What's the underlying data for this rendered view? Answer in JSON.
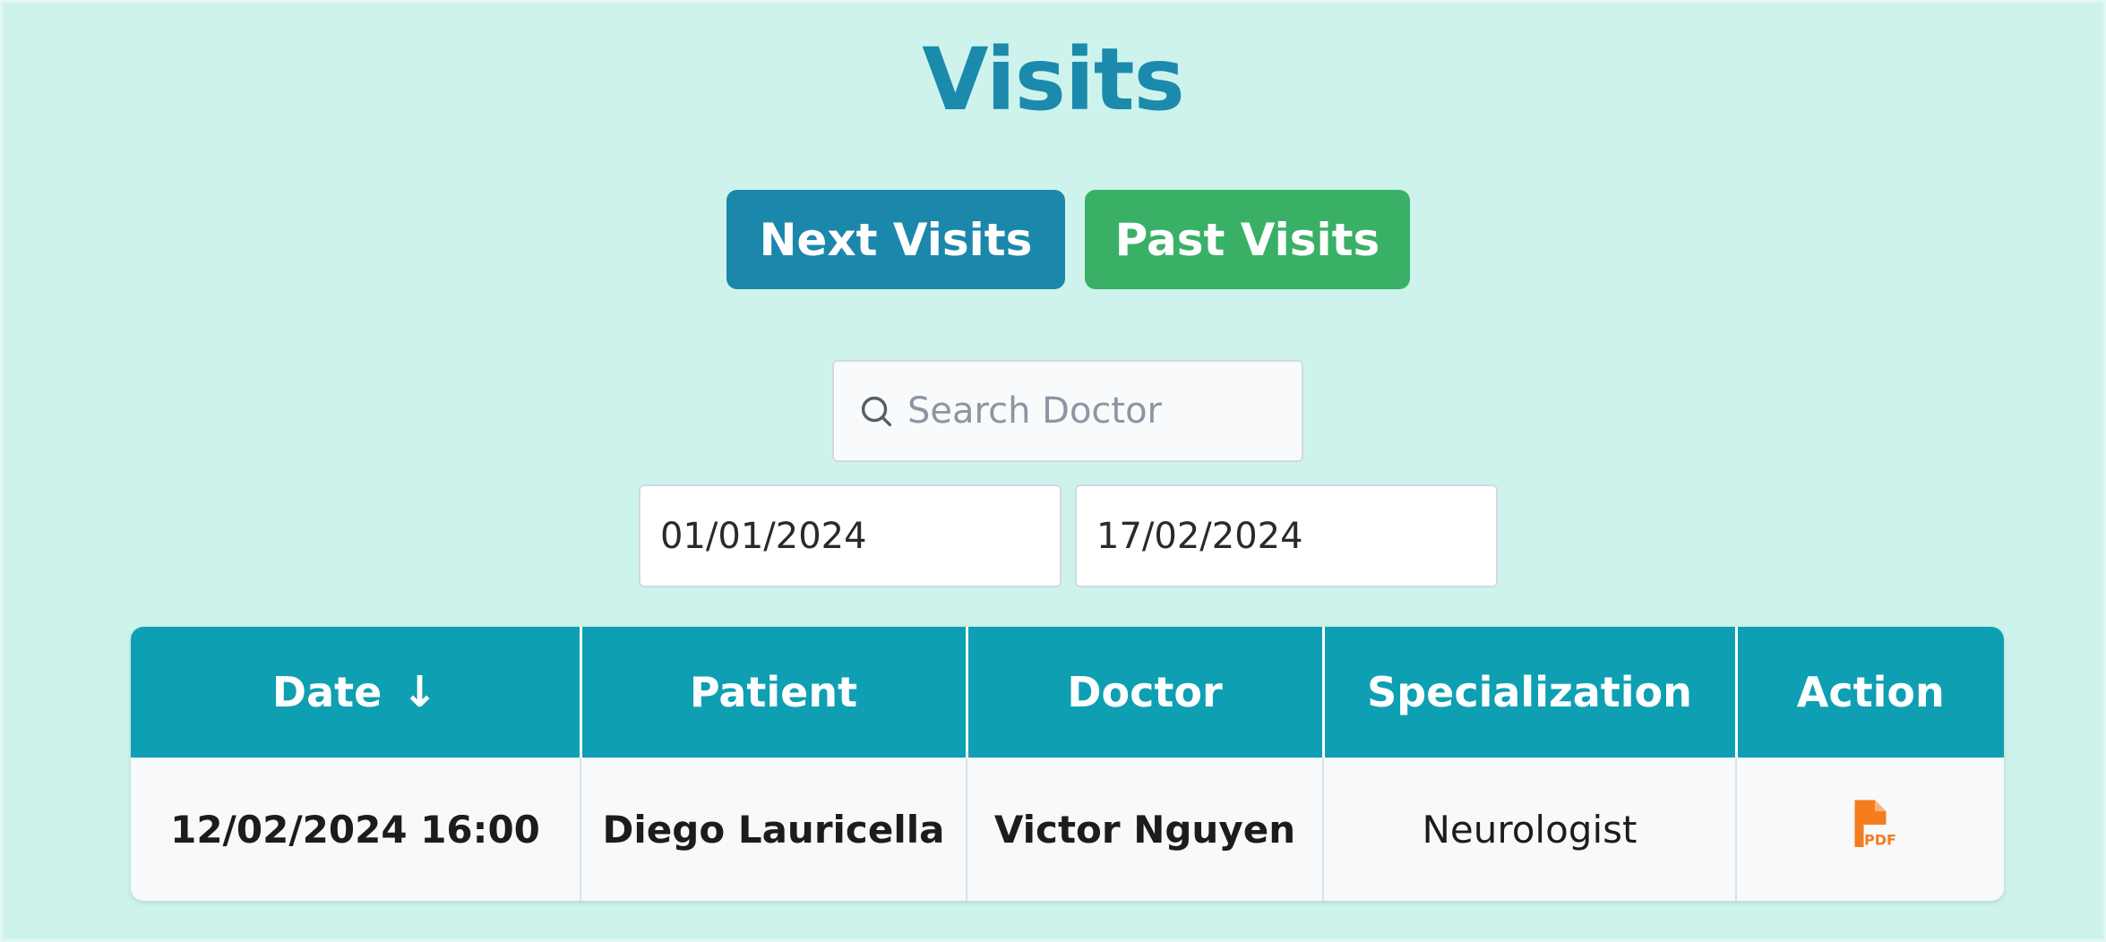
{
  "page": {
    "title": "Visits"
  },
  "toolbar": {
    "next_visits_label": "Next Visits",
    "past_visits_label": "Past Visits"
  },
  "search": {
    "placeholder": "Search Doctor",
    "value": ""
  },
  "date_range": {
    "from": "01/01/2024",
    "to": "17/02/2024"
  },
  "table": {
    "columns": [
      "Date",
      "Patient",
      "Doctor",
      "Specialization",
      "Action"
    ],
    "sort_icon": "arrow-down-icon",
    "rows": [
      {
        "date": "12/02/2024 16:00",
        "patient": "Diego Lauricella",
        "doctor": "Victor Nguyen",
        "specialization": "Neurologist",
        "action_icon": "pdf-icon"
      }
    ]
  },
  "colors": {
    "background": "#cdf3ec",
    "title": "#1b8aad",
    "next_button": "#1b87ab",
    "past_button": "#3ab067",
    "table_header": "#0f9fb2",
    "pdf_icon": "#f57c1f"
  }
}
